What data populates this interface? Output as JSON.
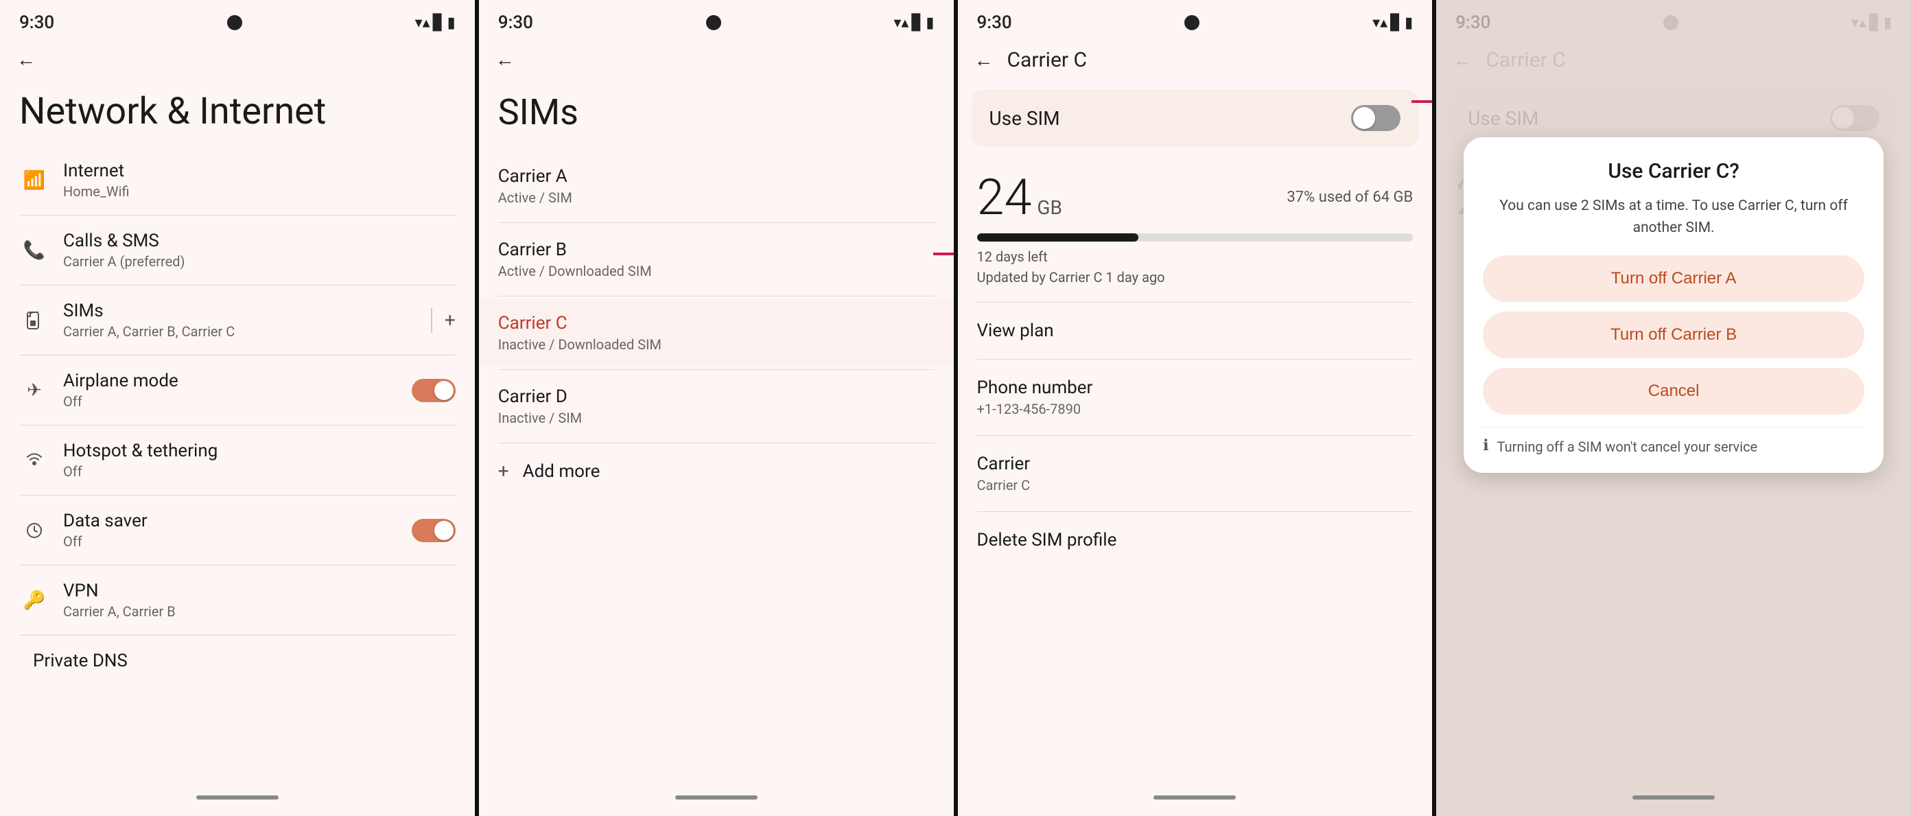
{
  "colors": {
    "bg": "#fdf6f4",
    "accent": "#d97b5a",
    "highlight_bg": "#f9ede8",
    "text_primary": "#1a1a1a",
    "text_secondary": "#666666",
    "toggle_on": "#d97b5a",
    "toggle_off": "#999999",
    "dialog_btn_bg": "#fce8e0",
    "dialog_btn_text": "#b84a1f",
    "arrow_color": "#cc1f4a"
  },
  "screen1": {
    "status_time": "9:30",
    "page_title": "Network & Internet",
    "back_arrow": "←",
    "menu_items": [
      {
        "icon": "wifi",
        "label": "Internet",
        "sublabel": "Home_Wifi"
      },
      {
        "icon": "phone",
        "label": "Calls & SMS",
        "sublabel": "Carrier A (preferred)"
      },
      {
        "icon": "sim",
        "label": "SIMs",
        "sublabel": "Carrier A, Carrier B, Carrier C",
        "has_divider": true,
        "has_plus": true
      },
      {
        "icon": "airplane",
        "label": "Airplane mode",
        "sublabel": "Off",
        "has_toggle": true,
        "toggle_on": true
      },
      {
        "icon": "hotspot",
        "label": "Hotspot & tethering",
        "sublabel": "Off"
      },
      {
        "icon": "data_saver",
        "label": "Data saver",
        "sublabel": "Off",
        "has_toggle": true,
        "toggle_on": true
      },
      {
        "icon": "vpn",
        "label": "VPN",
        "sublabel": "Carrier A, Carrier B"
      }
    ],
    "bottom_item": "Private DNS"
  },
  "screen2": {
    "status_time": "9:30",
    "title": "SIMs",
    "back_arrow": "←",
    "carriers": [
      {
        "name": "Carrier A",
        "status": "Active / SIM"
      },
      {
        "name": "Carrier B",
        "status": "Active / Downloaded SIM"
      },
      {
        "name": "Carrier C",
        "status": "Inactive / Downloaded SIM",
        "highlighted": true
      },
      {
        "name": "Carrier D",
        "status": "Inactive / SIM"
      }
    ],
    "add_more": "Add more"
  },
  "screen3": {
    "status_time": "9:30",
    "title": "Carrier C",
    "back_arrow": "←",
    "use_sim_label": "Use SIM",
    "use_sim_toggle": false,
    "data_number": "24",
    "data_unit": "GB",
    "data_percent": "37% used of 64 GB",
    "data_bar_pct": 37,
    "days_left": "12 days left",
    "updated": "Updated by Carrier C 1 day ago",
    "view_plan": "View plan",
    "phone_number_label": "Phone number",
    "phone_number_value": "+1-123-456-7890",
    "carrier_label": "Carrier",
    "carrier_value": "Carrier C",
    "delete_profile": "Delete SIM profile"
  },
  "screen4": {
    "status_time": "9:30",
    "title": "Carrier C",
    "back_arrow": "←",
    "use_sim_label": "Use SIM",
    "use_sim_toggle": false,
    "dialog": {
      "title": "Use Carrier C?",
      "description": "You can use 2 SIMs at a time. To use Carrier C, turn off another SIM.",
      "btn1": "Turn off Carrier A",
      "btn2": "Turn off Carrier B",
      "btn_cancel": "Cancel",
      "notice": "Turning off a SIM won't cancel your service"
    }
  }
}
